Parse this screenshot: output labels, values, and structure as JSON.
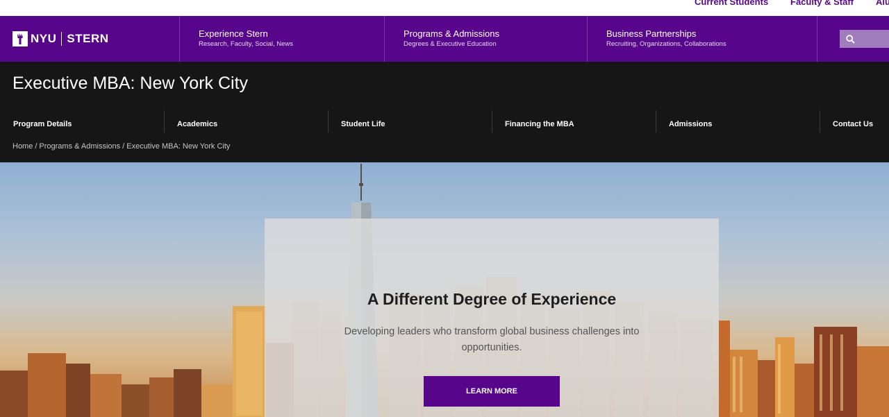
{
  "utility_nav": {
    "items": [
      "Current Students",
      "Faculty & Staff",
      "Alu"
    ]
  },
  "brand": {
    "logo_left": "NYU",
    "logo_right": "STERN",
    "color": "#57068c"
  },
  "main_nav": [
    {
      "title": "Experience Stern",
      "subtitle": "Research, Faculty, Social, News"
    },
    {
      "title": "Programs & Admissions",
      "subtitle": "Degrees & Executive Education"
    },
    {
      "title": "Business Partnerships",
      "subtitle": "Recruiting, Organizations, Collaborations"
    }
  ],
  "search": {
    "icon": "search-icon"
  },
  "page": {
    "title": "Executive MBA: New York City"
  },
  "sub_nav": [
    "Program Details",
    "Academics",
    "Student Life",
    "Financing the MBA",
    "Admissions",
    "Contact Us"
  ],
  "breadcrumb": [
    "Home",
    "Programs & Admissions",
    "Executive MBA: New York City"
  ],
  "hero": {
    "headline": "A Different Degree of Experience",
    "tagline": "Developing leaders who transform global business challenges into opportunities.",
    "cta_label": "LEARN MORE"
  }
}
